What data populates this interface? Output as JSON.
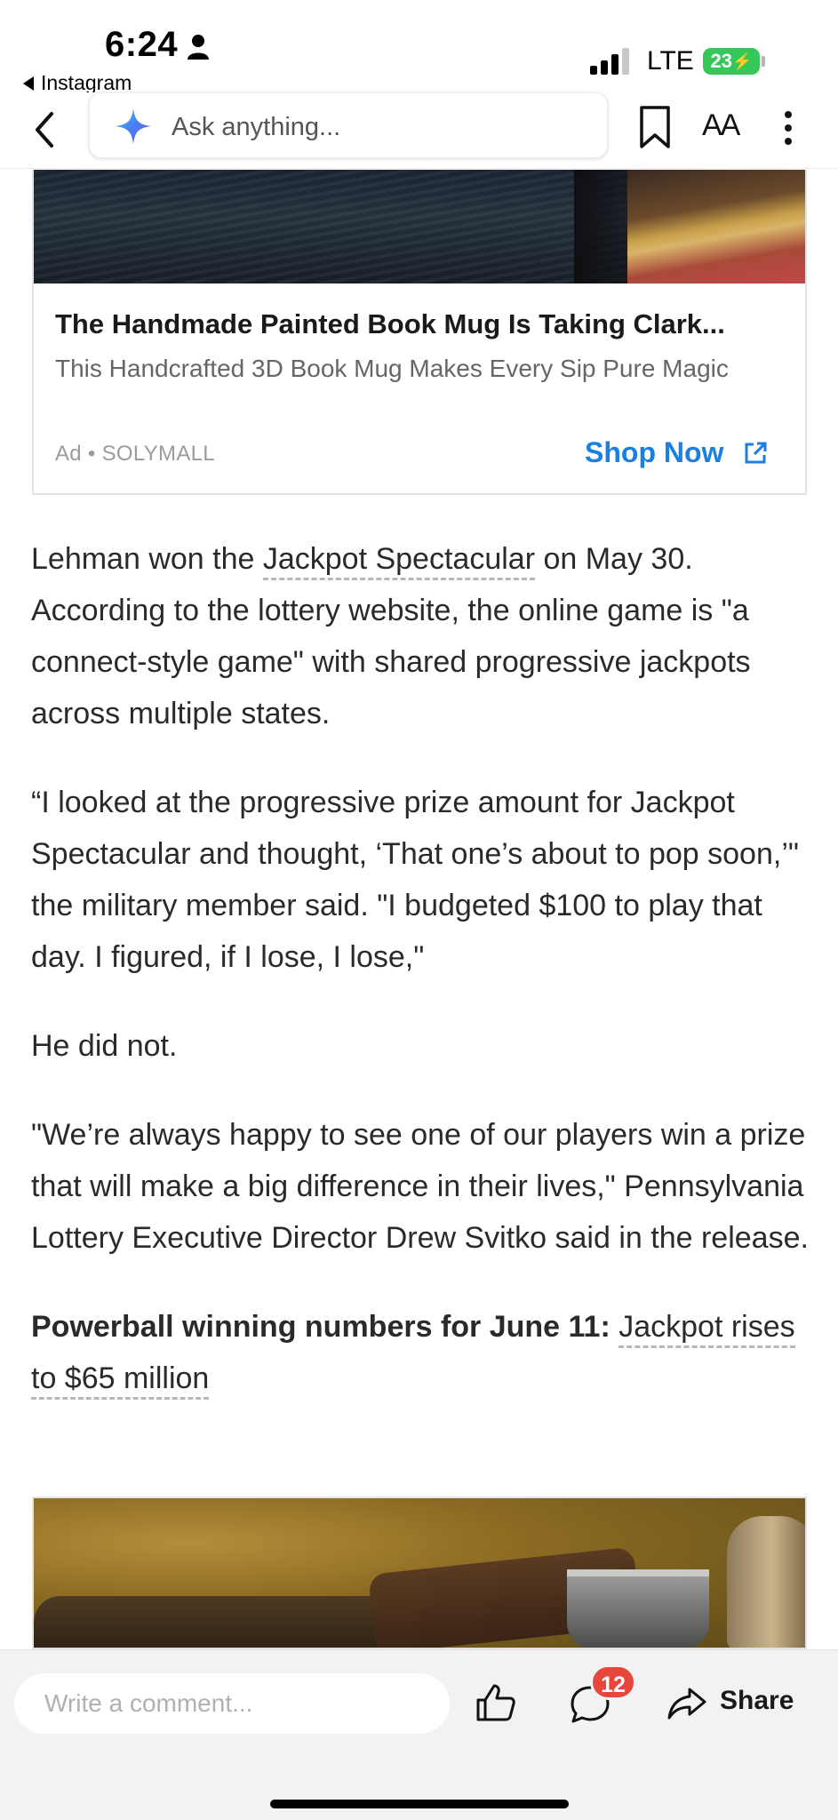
{
  "status_bar": {
    "time": "6:24",
    "back_app": "Instagram",
    "network": "LTE",
    "battery": "23"
  },
  "toolbar": {
    "ask_placeholder": "Ask anything...",
    "text_size_label": "AA"
  },
  "ad": {
    "title": "The Handmade Painted Book Mug Is Taking Clark...",
    "description": "This Handcrafted 3D Book Mug Makes Every Sip Pure Magic",
    "meta": "Ad • SOLYMALL",
    "cta": "Shop Now"
  },
  "article": {
    "p1_before": "Lehman won the ",
    "p1_link": "Jackpot Spectacular",
    "p1_after": " on May 30. According to the lottery website, the online game is \"a connect-style game\" with shared progressive jackpots across multiple states.",
    "p2": "“I looked at the progressive prize amount for Jackpot Spectacular and thought, ‘That one’s about to pop soon,’\" the military member said. \"I budgeted $100 to play that day. I figured, if I lose, I lose,\"",
    "p3": "He did not.",
    "p4": "\"We’re always happy to see one of our players win a prize that will make a big difference in their lives,\" Pennsylvania Lottery Executive Director Drew Svitko said in the release.",
    "p5_bold": "Powerball winning numbers for June 11:",
    "p5_link": "Jackpot rises to $65 million"
  },
  "bottom_bar": {
    "comment_placeholder": "Write a comment...",
    "comment_count": "12",
    "share_label": "Share"
  },
  "icons": {
    "back": "chevron-left-icon",
    "sparkle": "ai-sparkle-icon",
    "bookmark": "bookmark-icon",
    "more": "more-vertical-icon",
    "external": "external-link-icon",
    "like": "thumbs-up-icon",
    "comment": "comment-bubble-icon",
    "share": "share-arrow-icon"
  },
  "colors": {
    "accent": "#1a7fe0",
    "badge": "#e8453c",
    "battery": "#34c759"
  }
}
